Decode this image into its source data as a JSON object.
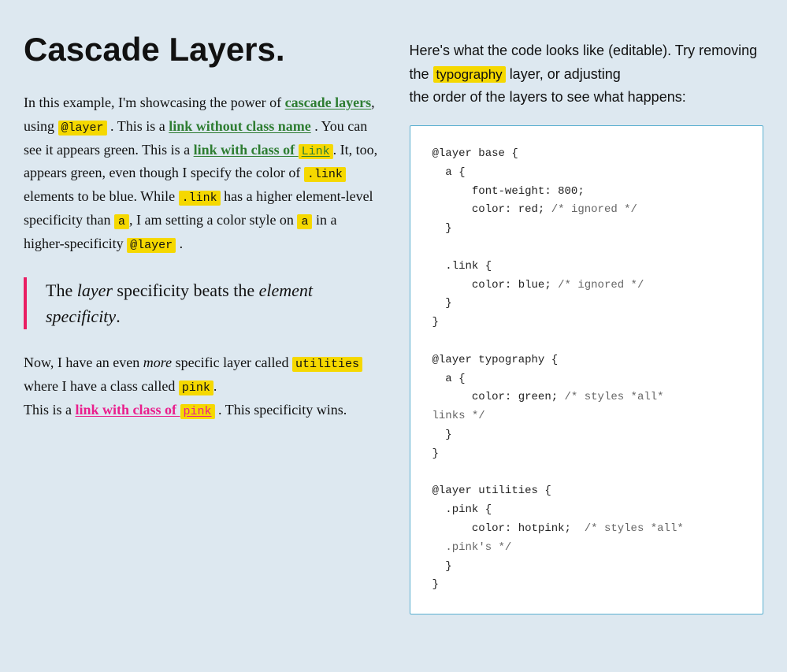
{
  "page": {
    "background": "#dde8f0"
  },
  "left": {
    "heading": "Cascade Layers.",
    "intro": "In this example, I'm showcasing the power of",
    "cascade_layers_link": "cascade layers",
    "layer_highlight": "@layer",
    "sentence1": ". This is a",
    "link_without_class": "link without class name",
    "sentence2": ". You can see it appears green. This is a",
    "link_with_class_of": "link with class of",
    "link_highlight": "Link",
    "sentence3": ". It, too, appears green, even though I specify the color of",
    "link_code1": ".link",
    "sentence4": "elements to be blue. While",
    "link_code2": ".link",
    "sentence5": "has a higher element-level specificity than",
    "a_char": "a",
    "sentence6": ", I am setting a color style on",
    "a_char2": "a",
    "sentence7": "in a higher-specificity",
    "layer_code": "@layer",
    "sentence8": ".",
    "blockquote": "The layer specificity beats the element specificity.",
    "now_text": "Now, I have an even",
    "more_em": "more",
    "specific_text": "specific layer called",
    "utilities_highlight": "utilities",
    "where_text": "where I have a class called",
    "pink_highlight": "pink",
    "period": ".",
    "this_is_a": "This is a",
    "pink_link_text": "link with class of",
    "pink_link_highlight": "pink",
    "this_spec": ". This specificity wins."
  },
  "right": {
    "intro_line1": "Here's what the code looks like (editable). Try",
    "intro_line2": "removing the",
    "typography_highlight": "typography",
    "intro_line3": "layer, or adjusting",
    "intro_line4": "the order of the layers to see what happens:",
    "code": "@layer base {\n  a {\n      font-weight: 800;\n      color: red; /* ignored */\n  }\n\n  .link {\n      color: blue; /* ignored */\n  }\n}\n\n@layer typography {\n  a {\n      color: green; /* styles *all*\nlinks */\n  }\n}\n\n@layer utilities {\n  .pink {\n      color: hotpink;  /* styles *all*\n  .pink's */\n  }\n}"
  }
}
